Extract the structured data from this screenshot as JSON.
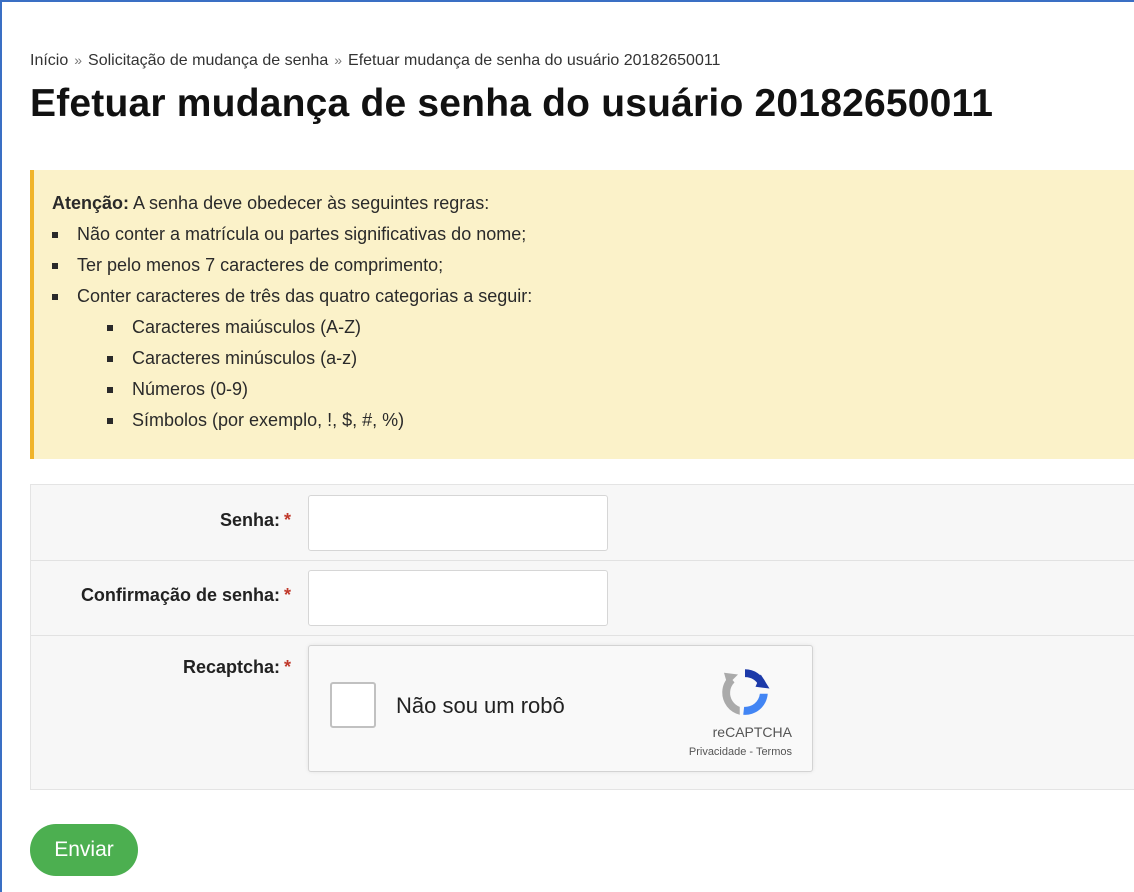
{
  "breadcrumb": {
    "items": [
      "Início",
      "Solicitação de mudança de senha",
      "Efetuar mudança de senha do usuário 20182650011"
    ],
    "separator": "»"
  },
  "page": {
    "title": "Efetuar mudança de senha do usuário 20182650011"
  },
  "alert": {
    "label": "Atenção:",
    "intro": " A senha deve obedecer às seguintes regras:",
    "rules": [
      "Não conter a matrícula ou partes significativas do nome;",
      "Ter pelo menos 7 caracteres de comprimento;",
      "Conter caracteres de três das quatro categorias a seguir:"
    ],
    "categories": [
      "Caracteres maiúsculos (A-Z)",
      "Caracteres minúsculos (a-z)",
      "Números (0-9)",
      "Símbolos (por exemplo, !, $, #, %)"
    ],
    "background_color": "#fbf2c9",
    "accent_color": "#f0b429"
  },
  "form": {
    "password": {
      "label": "Senha:",
      "required_mark": "*",
      "value": ""
    },
    "confirm": {
      "label": "Confirmação de senha:",
      "required_mark": "*",
      "value": ""
    },
    "recaptcha": {
      "label": "Recaptcha:",
      "required_mark": "*",
      "checkbox_text": "Não sou um robô",
      "brand": "reCAPTCHA",
      "privacy": "Privacidade",
      "links_sep": " - ",
      "terms": "Termos",
      "icon": "recaptcha-logo-icon"
    },
    "submit_label": "Enviar",
    "submit_color": "#4caf50"
  }
}
